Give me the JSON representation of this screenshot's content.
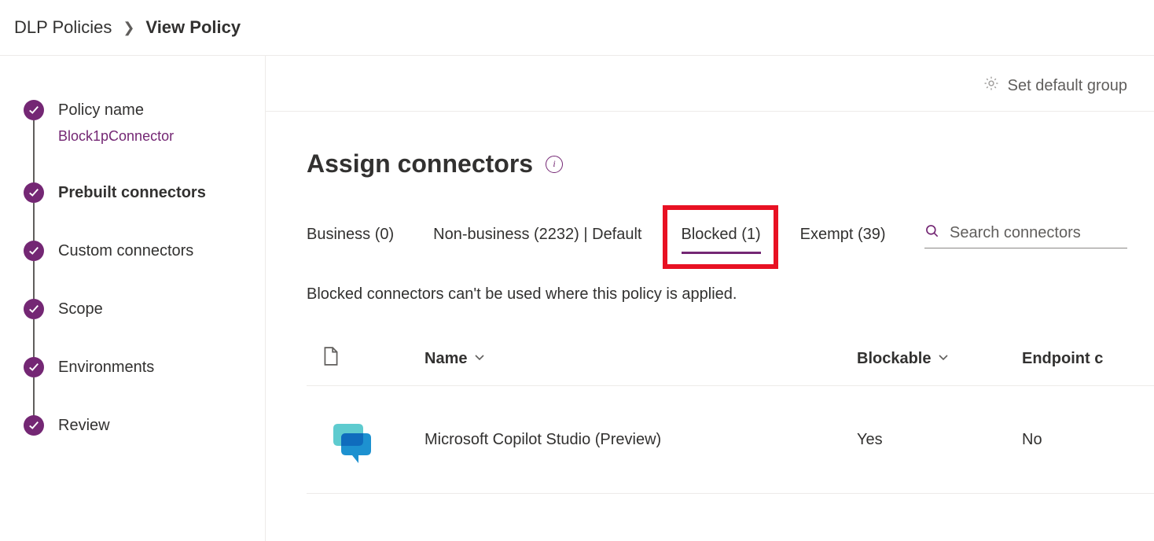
{
  "breadcrumb": {
    "parent": "DLP Policies",
    "current": "View Policy"
  },
  "sidebar": {
    "steps": [
      {
        "label": "Policy name",
        "sub": "Block1pConnector",
        "active": false
      },
      {
        "label": "Prebuilt connectors",
        "sub": null,
        "active": true
      },
      {
        "label": "Custom connectors",
        "sub": null,
        "active": false
      },
      {
        "label": "Scope",
        "sub": null,
        "active": false
      },
      {
        "label": "Environments",
        "sub": null,
        "active": false
      },
      {
        "label": "Review",
        "sub": null,
        "active": false
      }
    ]
  },
  "toolbar": {
    "set_default_label": "Set default group"
  },
  "main": {
    "title": "Assign connectors",
    "tabs": [
      {
        "label": "Business (0)",
        "selected": false
      },
      {
        "label": "Non-business (2232) | Default",
        "selected": false
      },
      {
        "label": "Blocked (1)",
        "selected": true,
        "highlighted": true
      },
      {
        "label": "Exempt (39)",
        "selected": false
      }
    ],
    "search_placeholder": "Search connectors",
    "tab_description": "Blocked connectors can't be used where this policy is applied.",
    "table": {
      "columns": [
        "",
        "Name",
        "Blockable",
        "Endpoint c"
      ],
      "rows": [
        {
          "name": "Microsoft Copilot Studio (Preview)",
          "blockable": "Yes",
          "endpoint": "No"
        }
      ]
    }
  }
}
